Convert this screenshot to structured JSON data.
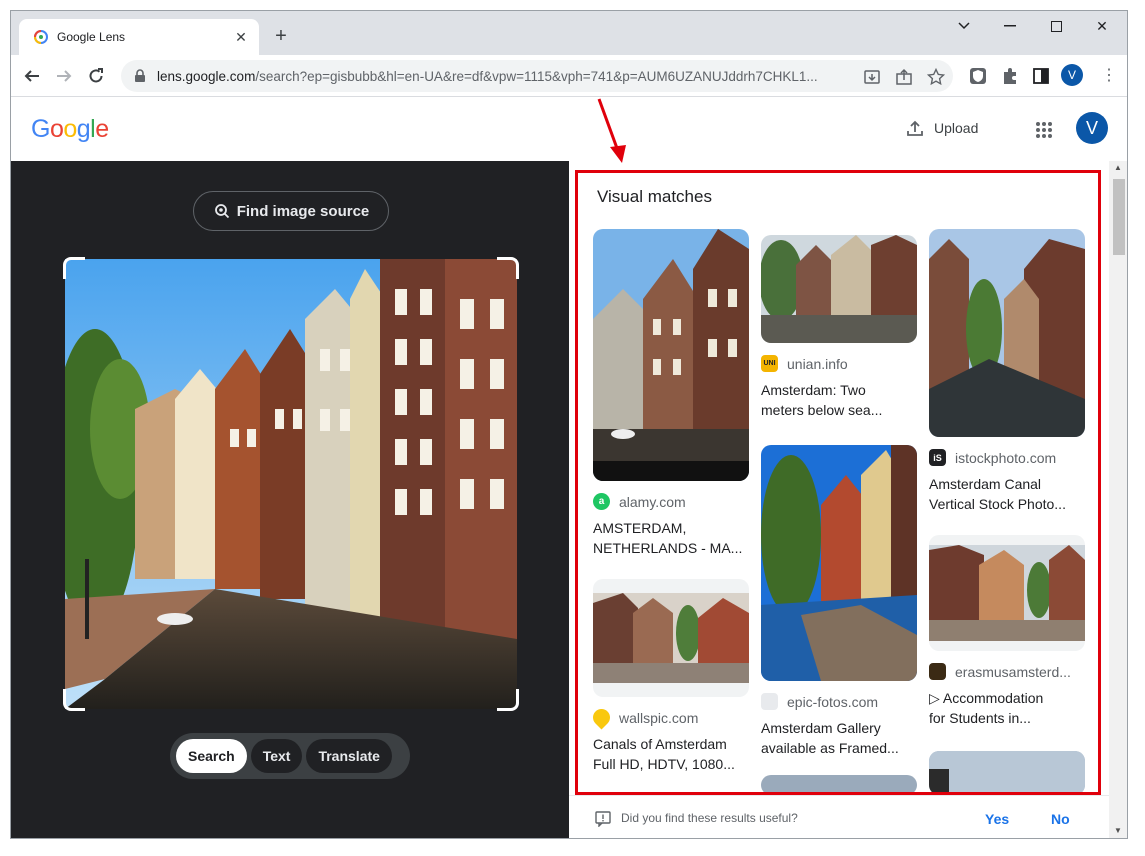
{
  "browser": {
    "tab_title": "Google Lens",
    "url_host": "lens.google.com",
    "url_path": "/search?ep=gisbubb&hl=en-UA&re=df&vpw=1115&vph=741&p=AUM6UZANUJddrh7CHKL1...",
    "profile_initial": "V"
  },
  "lens": {
    "logo": "Google",
    "upload_label": "Upload",
    "avatar_initial": "V",
    "find_source_label": "Find image source",
    "modes": [
      "Search",
      "Text",
      "Translate"
    ]
  },
  "results": {
    "title": "Visual matches",
    "cards": [
      {
        "source": "alamy.com",
        "title1": "AMSTERDAM,",
        "title2": "NETHERLANDS - MA...",
        "icon_color": "#1ec663"
      },
      {
        "source": "wallspic.com",
        "title1": "Canals of Amsterdam",
        "title2": "Full HD, HDTV, 1080...",
        "icon_color": "#f9c80e"
      },
      {
        "source": "unian.info",
        "title1": "Amsterdam: Two",
        "title2": "meters below sea...",
        "icon_color": "#f4b400"
      },
      {
        "source": "epic-fotos.com",
        "title1": "Amsterdam Gallery",
        "title2": "available as Framed...",
        "icon_color": "#e8eaed"
      },
      {
        "source": "istockphoto.com",
        "title1": "Amsterdam Canal",
        "title2": "Vertical Stock Photo...",
        "icon_color": "#202124"
      },
      {
        "source": "erasmusamsterd...",
        "title1": "▷ Accommodation",
        "title2": "for Students in...",
        "icon_color": "#3b2a14"
      }
    ],
    "feedback_question": "Did you find these results useful?",
    "yes_label": "Yes",
    "no_label": "No"
  },
  "annotation_color": "#e0000b"
}
